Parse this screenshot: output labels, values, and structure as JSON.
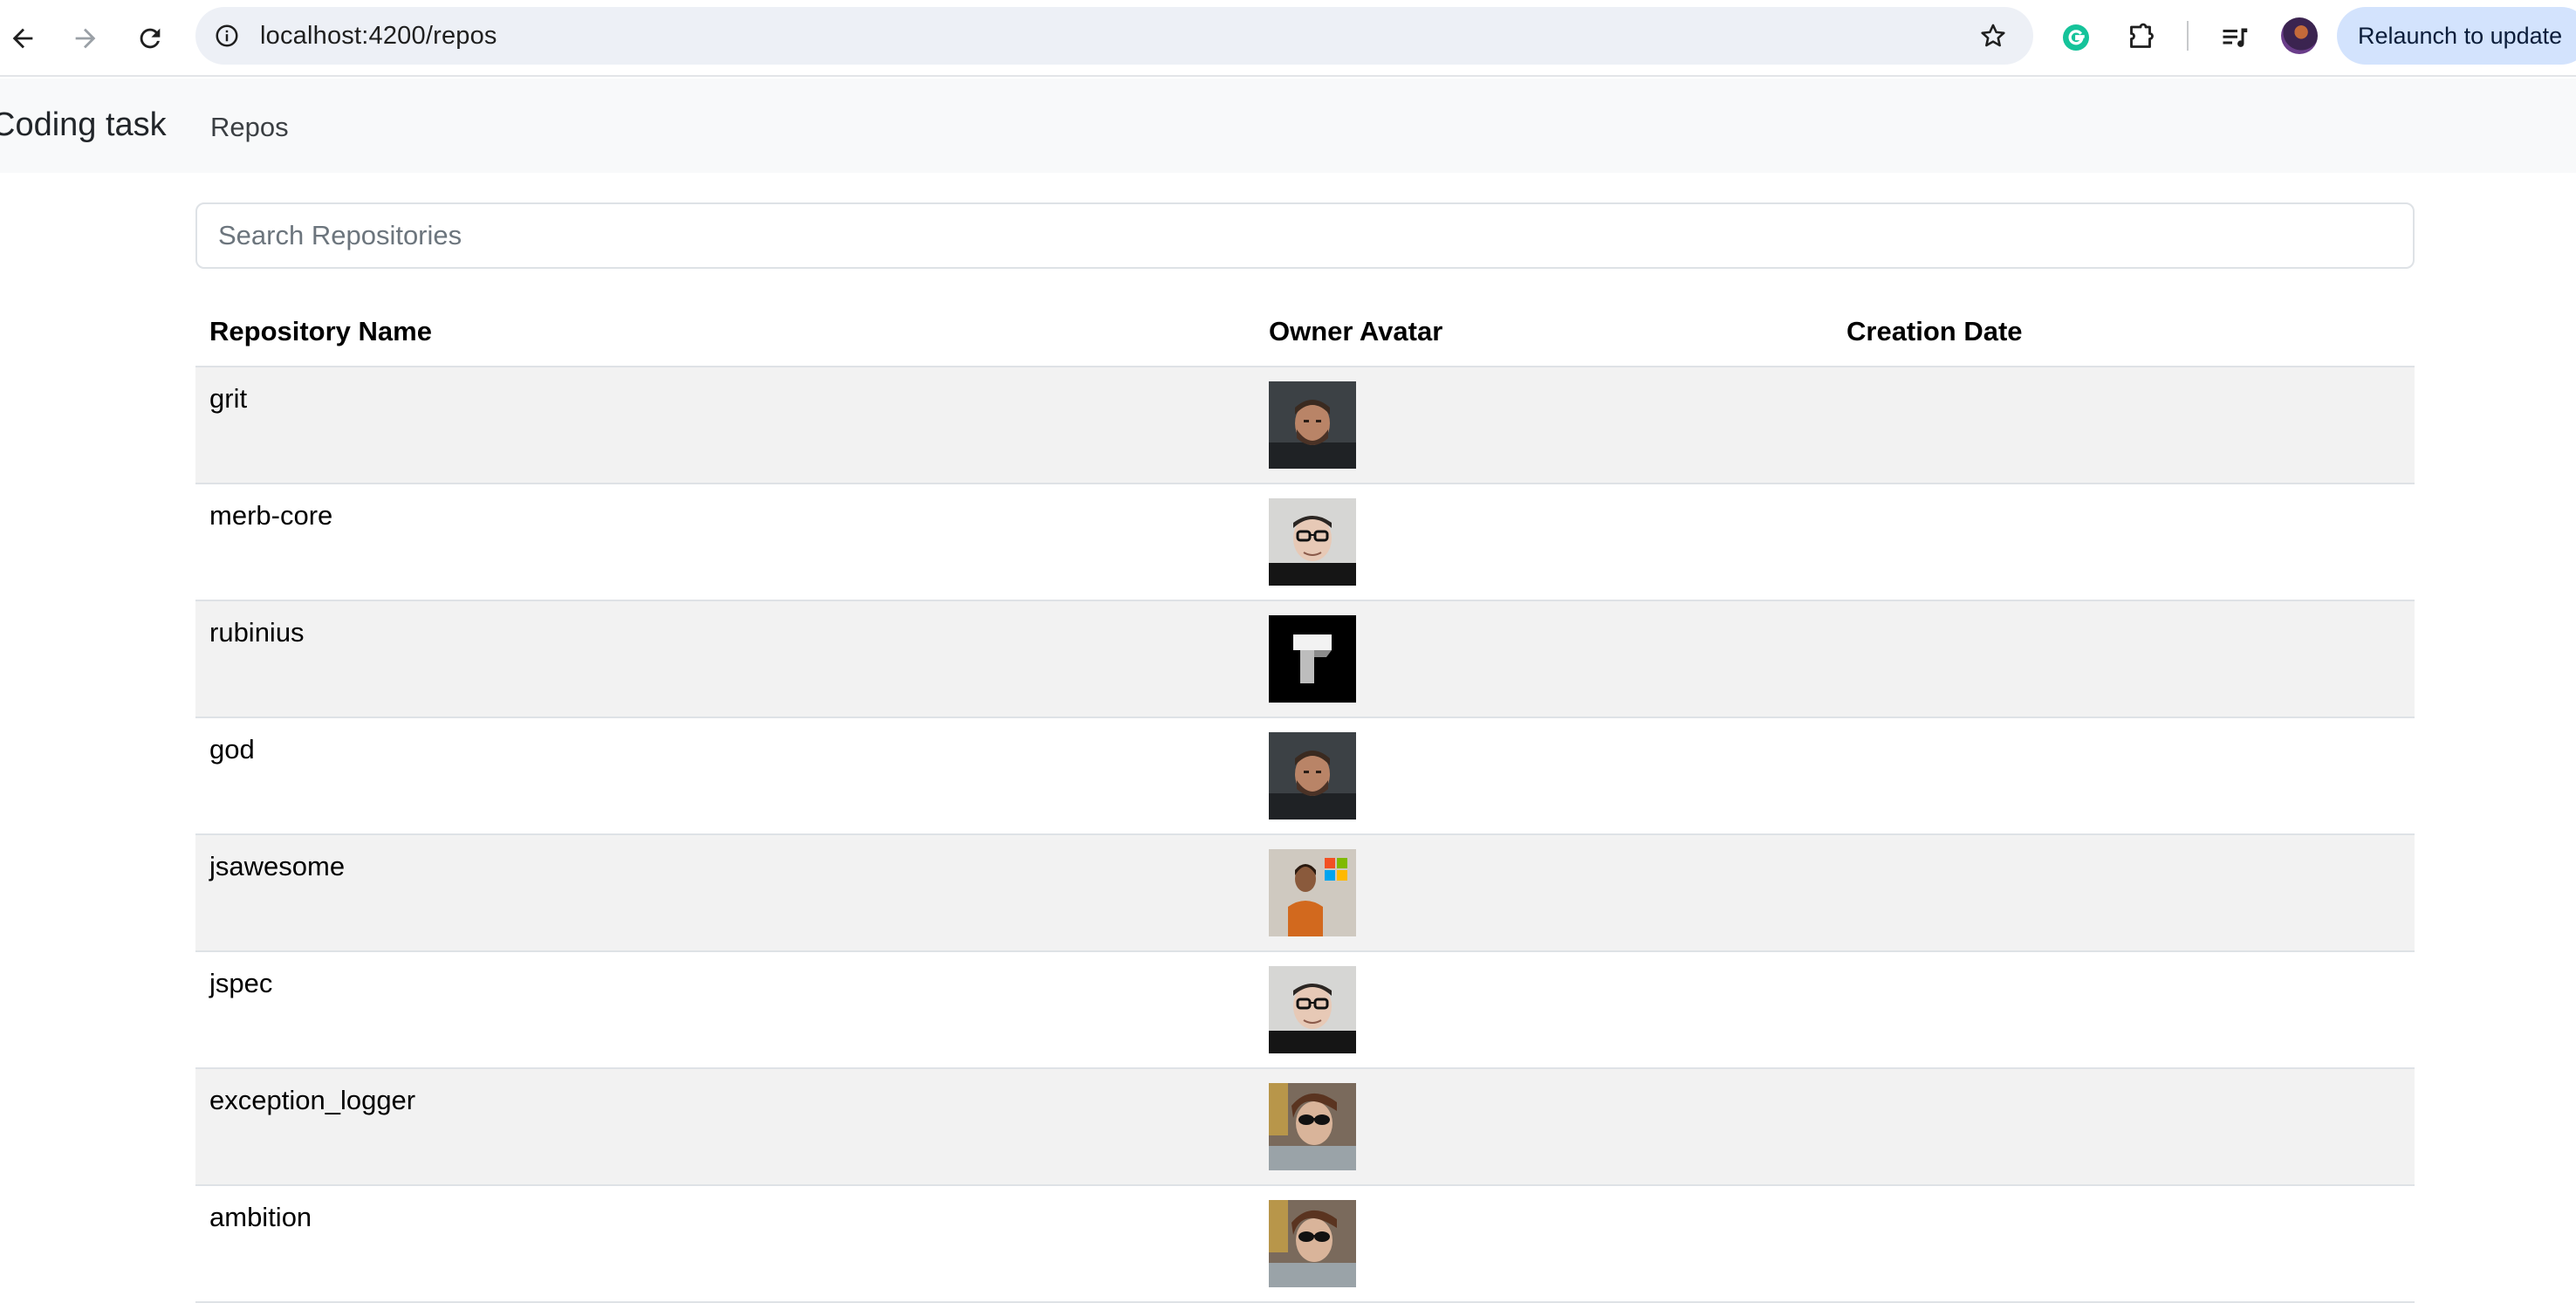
{
  "browser": {
    "url": "localhost:4200/repos",
    "relaunch_label": "Relaunch to update"
  },
  "navbar": {
    "brand": "Coding task",
    "link_repos": "Repos"
  },
  "search": {
    "placeholder": "Search Repositories",
    "value": ""
  },
  "table": {
    "headers": [
      "Repository Name",
      "Owner Avatar",
      "Creation Date"
    ],
    "rows": [
      {
        "name": "grit",
        "avatar": "bearded-man-portrait",
        "date": ""
      },
      {
        "name": "merb-core",
        "avatar": "man-with-glasses-portrait",
        "date": ""
      },
      {
        "name": "rubinius",
        "avatar": "rubinius-logo",
        "date": ""
      },
      {
        "name": "god",
        "avatar": "bearded-man-portrait",
        "date": ""
      },
      {
        "name": "jsawesome",
        "avatar": "man-orange-shirt-portrait",
        "date": ""
      },
      {
        "name": "jspec",
        "avatar": "man-with-glasses-portrait",
        "date": ""
      },
      {
        "name": "exception_logger",
        "avatar": "man-sunglasses-portrait",
        "date": ""
      },
      {
        "name": "ambition",
        "avatar": "man-sunglasses-portrait",
        "date": ""
      }
    ]
  }
}
